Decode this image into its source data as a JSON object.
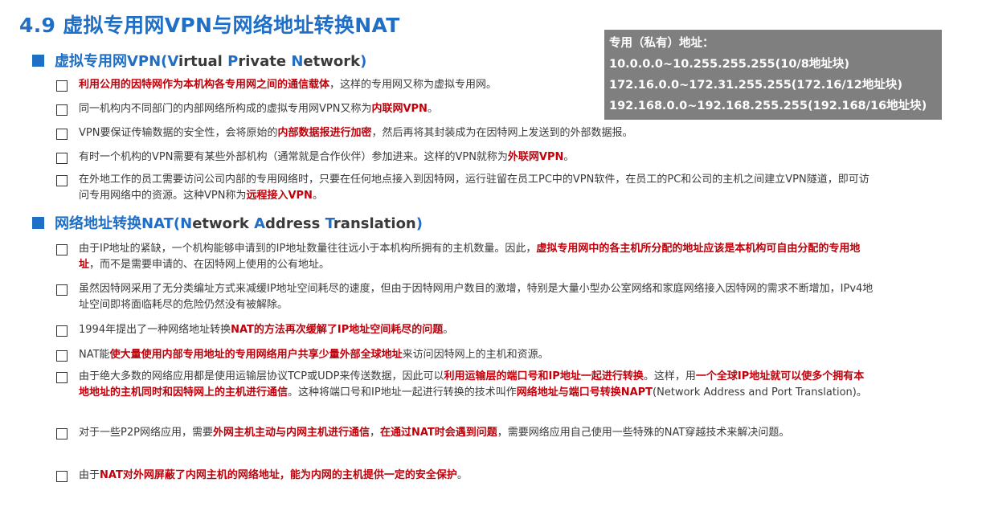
{
  "title": "4.9 虚拟专用网VPN与网络地址转换NAT",
  "private_box": {
    "heading": "专用（私有）地址：",
    "ranges": [
      "10.0.0.0~10.255.255.255(10/8地址块)",
      "172.16.0.0~172.31.255.255(172.16/12地址块)",
      "192.168.0.0~192.168.255.255(192.168/16地址块)"
    ]
  },
  "sections": [
    {
      "header_main": "虚拟专用网VPN(",
      "header_terms": [
        {
          "initial": "V",
          "rest": "irtual "
        },
        {
          "initial": "P",
          "rest": "rivate "
        },
        {
          "initial": "N",
          "rest": "etwork"
        }
      ],
      "header_close": ")"
    },
    {
      "header_main": "网络地址转换NAT(",
      "header_terms": [
        {
          "initial": "N",
          "rest": "etwork "
        },
        {
          "initial": "A",
          "rest": "ddress "
        },
        {
          "initial": "T",
          "rest": "ranslation"
        }
      ],
      "header_close": ")"
    }
  ],
  "items": [
    [
      {
        "red": "利用公用的因特网作为本机构各专用网之间的通信载体"
      },
      {
        "text": "，这样的专用网又称为虚拟专用网。"
      }
    ],
    [
      {
        "text": "同一机构内不同部门的内部网络所构成的虚拟专用网VPN又称为"
      },
      {
        "red": "内联网VPN"
      },
      {
        "text": "。"
      }
    ],
    [
      {
        "text": "VPN要保证传输数据的安全性，会将原始的"
      },
      {
        "red": "内部数据报进行加密"
      },
      {
        "text": "，然后再将其封装成为在因特网上发送到的外部数据报。"
      }
    ],
    [
      {
        "text": "有时一个机构的VPN需要有某些外部机构（通常就是合作伙伴）参加进来。这样的VPN就称为"
      },
      {
        "red": "外联网VPN"
      },
      {
        "text": "。"
      }
    ],
    [
      {
        "text": "在外地工作的员工需要访问公司内部的专用网络时，只要在任何地点接入到因特网，运行驻留在员工PC中的VPN软件，在员工的PC和公司的主机之间建立VPN隧道，即可访问专用网络中的资源。这种VPN称为"
      },
      {
        "red": "远程接入VPN"
      },
      {
        "text": "。"
      }
    ],
    [
      {
        "text": "由于IP地址的紧缺，一个机构能够申请到的IP地址数量往往远小于本机构所拥有的主机数量。因此，"
      },
      {
        "red": "虚拟专用网中的各主机所分配的地址应该是本机构可自由分配的专用地址"
      },
      {
        "text": "，而不是需要申请的、在因特网上使用的公有地址。"
      }
    ],
    [
      {
        "text": "虽然因特网采用了无分类编址方式来减缓IP地址空间耗尽的速度，但由于因特网用户数目的激增，特别是大量小型办公室网络和家庭网络接入因特网的需求不断增加，IPv4地址空间即将面临耗尽的危险仍然没有被解除。"
      }
    ],
    [
      {
        "text": "1994年提出了一种网络地址转换"
      },
      {
        "red": "NAT的方法再次缓解了IP地址空间耗尽的问题"
      },
      {
        "text": "。"
      }
    ],
    [
      {
        "text": "NAT能"
      },
      {
        "red": "使大量使用内部专用地址的专用网络用户共享少量外部全球地址"
      },
      {
        "text": "来访问因特网上的主机和资源。"
      }
    ],
    [
      {
        "text": "由于绝大多数的网络应用都是使用运输层协议TCP或UDP来传送数据，因此可以"
      },
      {
        "red": "利用运输层的端口号和IP地址一起进行转换"
      },
      {
        "text": "。这样，用"
      },
      {
        "red": "一个全球IP地址就可以使多个拥有本地地址的主机同时和因特网上的主机进行通信"
      },
      {
        "text": "。这种将端口号和IP地址一起进行转换的技术叫作"
      },
      {
        "red": "网络地址与端口号转换NAPT"
      },
      {
        "text": "(Network Address and Port Translation)。"
      }
    ],
    [
      {
        "text": "对于一些P2P网络应用，需要"
      },
      {
        "red": "外网主机主动与内网主机进行通信"
      },
      {
        "text": "，"
      },
      {
        "red": "在通过NAT时会遇到问题"
      },
      {
        "text": "，需要网络应用自己使用一些特殊的NAT穿越技术来解决问题。"
      }
    ],
    [
      {
        "text": "由于"
      },
      {
        "red": "NAT对外网屏蔽了内网主机的网络地址，能为内网的主机提供一定的安全保护"
      },
      {
        "text": "。"
      }
    ]
  ],
  "colors": {
    "title_blue": "#1f6fc6",
    "highlight_red": "#c0000a",
    "box_gray": "#7f7f7f"
  }
}
